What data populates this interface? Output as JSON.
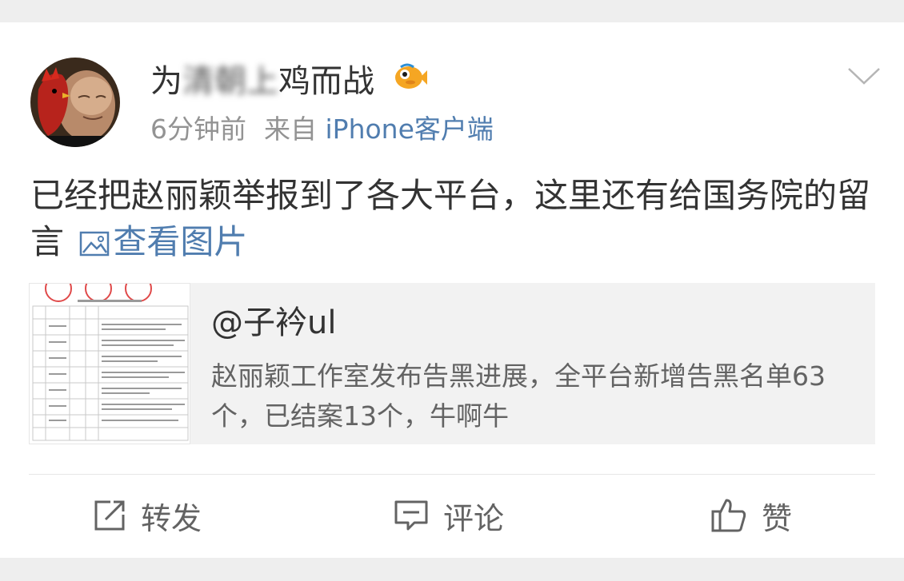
{
  "post": {
    "user": {
      "name_start": "为",
      "name_blurred": "清朝上",
      "name_end": "鸡而战"
    },
    "time": "6分钟前",
    "source_prefix": "来自",
    "source": "iPhone客户端",
    "text": "已经把赵丽颖举报到了各大平台，这里还有给国务院的留言",
    "view_pics_label": "查看图片"
  },
  "quoted": {
    "user": "@子衿ul",
    "text": "赵丽颖工作室发布告黑进展，全平台新增告黑名单63个，已结案13个，牛啊牛"
  },
  "actions": {
    "repost": "转发",
    "comment": "评论",
    "like": "赞"
  },
  "colors": {
    "link": "#507daf",
    "meta": "#939393",
    "text": "#333333",
    "quote_bg": "#f2f2f2",
    "page_bg": "#eeeeee"
  },
  "icons": {
    "vip": "fish-vip-icon",
    "more": "chevron-down-icon",
    "image": "image-icon",
    "repost": "repost-icon",
    "comment": "comment-icon",
    "like": "thumbs-up-icon"
  }
}
